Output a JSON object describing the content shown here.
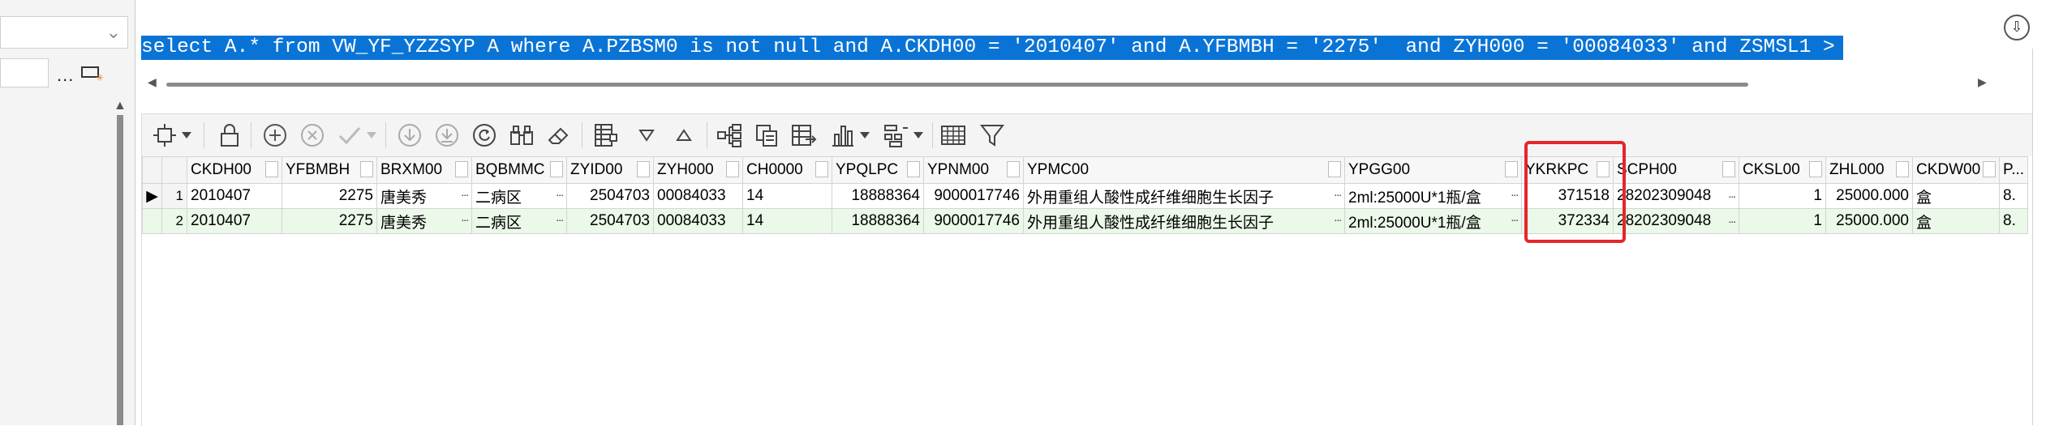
{
  "sql": {
    "text": "select A.* from VW_YF_YZZSYP A where A.PZBSM0 is not null and A.CKDH00 = '2010407' and A.YFBMBH = '2275'  and ZYH000 = '00084033' and ZSMSL1 >"
  },
  "left_panel": {
    "more_label": "..."
  },
  "toolbar": {
    "icons": [
      "transform-icon",
      "dropdown-arrow-icon",
      "lock-icon",
      "add-icon",
      "delete-icon",
      "check-icon",
      "dropdown-arrow-icon",
      "down-circle-icon",
      "down-circle-icon",
      "refresh-icon",
      "binoculars-icon",
      "eraser-icon",
      "grid-columns-icon",
      "triangle-down-icon",
      "triangle-up-icon",
      "tree-icon",
      "copy-icon",
      "export-icon",
      "bar-chart-icon",
      "dropdown-arrow-icon",
      "group-icon",
      "dropdown-arrow-icon",
      "table-icon",
      "filter-icon"
    ]
  },
  "grid": {
    "columns": [
      "CKDH00",
      "YFBMBH",
      "BRXM00",
      "BQBMMC",
      "ZYID00",
      "ZYH000",
      "CH0000",
      "YPQLPC",
      "YPNM00",
      "YPMC00",
      "YPGG00",
      "YKRKPC",
      "SCPH00",
      "CKSL00",
      "ZHL000",
      "CKDW00",
      "P..."
    ],
    "rows": [
      {
        "num": "1",
        "CKDH00": "2010407",
        "YFBMBH": "2275",
        "BRXM00": "唐美秀",
        "BQBMMC": "二病区",
        "ZYID00": "2504703",
        "ZYH000": "00084033",
        "CH0000": "14",
        "YPQLPC": "18888364",
        "YPNM00": "9000017746",
        "YPMC00": "外用重组人酸性成纤维细胞生长因子",
        "YPGG00": "2ml:25000U*1瓶/盒",
        "YKRKPC": "371518",
        "SCPH00": "28202309048",
        "CKSL00": "1",
        "ZHL000": "25000.000",
        "CKDW00": "盒",
        "P": "8."
      },
      {
        "num": "2",
        "CKDH00": "2010407",
        "YFBMBH": "2275",
        "BRXM00": "唐美秀",
        "BQBMMC": "二病区",
        "ZYID00": "2504703",
        "ZYH000": "00084033",
        "CH0000": "14",
        "YPQLPC": "18888364",
        "YPNM00": "9000017746",
        "YPMC00": "外用重组人酸性成纤维细胞生长因子",
        "YPGG00": "2ml:25000U*1瓶/盒",
        "YKRKPC": "372334",
        "SCPH00": "28202309048",
        "CKSL00": "1",
        "ZHL000": "25000.000",
        "CKDW00": "盒",
        "P": "8."
      }
    ],
    "current_row_marker": "▶",
    "ellipsis": "..."
  },
  "colors": {
    "selection": "#0a74d6",
    "highlight_box": "#e5262b",
    "alt_row": "#eaf9e8"
  }
}
